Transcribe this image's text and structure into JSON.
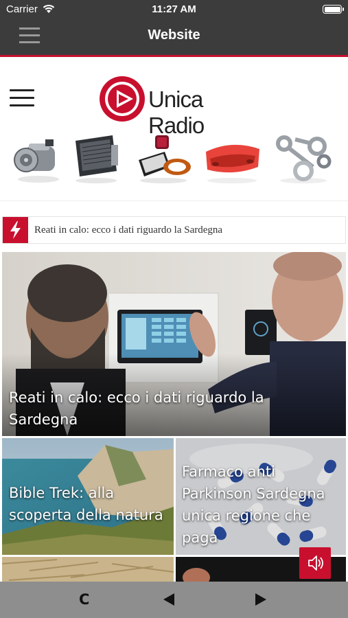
{
  "status_bar": {
    "carrier": "Carrier",
    "time": "11:27 AM"
  },
  "nav": {
    "title": "Website",
    "menu_icon": "hamburger-icon"
  },
  "site": {
    "logo_text": "Unica Radio",
    "brand_color": "#c8102e",
    "menu_icon": "hamburger-icon",
    "products": [
      "ac-compressor",
      "radiator",
      "air-filters",
      "bumper",
      "connecting-rods"
    ]
  },
  "ticker": {
    "icon": "lightning-icon",
    "text": "Reati in calo: ecco i dati riguardo la Sardegna"
  },
  "articles": {
    "hero": {
      "headline": "Reati in calo: ecco i dati riguardo la Sardegna"
    },
    "trek": {
      "headline": "Bible Trek: alla scoperta della natura"
    },
    "farmaco": {
      "headline": "Farmaco anti Parkinson Sardegna unica regione che paga"
    }
  },
  "sound_button": {
    "icon": "speaker-icon"
  },
  "toolbar": {
    "reload_label": "C",
    "back_icon": "triangle-left-icon",
    "forward_icon": "triangle-right-icon"
  }
}
